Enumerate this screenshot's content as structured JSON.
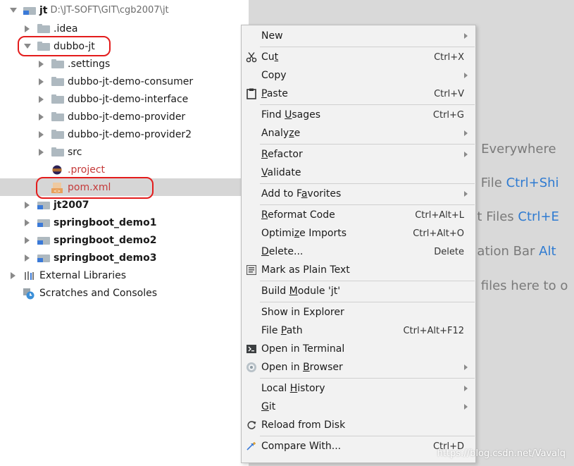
{
  "tree": {
    "root": {
      "label": "jt",
      "path": "D:\\JT-SOFT\\GIT\\cgb2007\\jt"
    },
    "items": [
      {
        "label": ".idea"
      },
      {
        "label": "dubbo-jt"
      },
      {
        "label": ".settings"
      },
      {
        "label": "dubbo-jt-demo-consumer"
      },
      {
        "label": "dubbo-jt-demo-interface"
      },
      {
        "label": "dubbo-jt-demo-provider"
      },
      {
        "label": "dubbo-jt-demo-provider2"
      },
      {
        "label": "src"
      },
      {
        "label": ".project"
      },
      {
        "label": "pom.xml"
      },
      {
        "label": "jt2007"
      },
      {
        "label": "springboot_demo1"
      },
      {
        "label": "springboot_demo2"
      },
      {
        "label": "springboot_demo3"
      },
      {
        "label": "External Libraries"
      },
      {
        "label": "Scratches and Consoles"
      }
    ]
  },
  "editor": {
    "hints": [
      {
        "text": "h Everywhere",
        "key": ""
      },
      {
        "text": "o File ",
        "key": "Ctrl+Shi"
      },
      {
        "text": "nt Files ",
        "key": "Ctrl+E"
      },
      {
        "text": "gation Bar ",
        "key": "Alt"
      },
      {
        "text": "o files here to o",
        "key": ""
      }
    ]
  },
  "menu": {
    "new": {
      "label": "New"
    },
    "cut": {
      "pre": "Cu",
      "u": "t",
      "post": "",
      "shortcut": "Ctrl+X"
    },
    "copy": {
      "label": "Copy"
    },
    "paste": {
      "pre": "",
      "u": "P",
      "post": "aste",
      "shortcut": "Ctrl+V"
    },
    "find_usages": {
      "pre": "Find ",
      "u": "U",
      "post": "sages",
      "shortcut": "Ctrl+G"
    },
    "analyze": {
      "pre": "Analy",
      "u": "z",
      "post": "e"
    },
    "refactor": {
      "pre": "",
      "u": "R",
      "post": "efactor"
    },
    "validate": {
      "pre": "",
      "u": "V",
      "post": "alidate"
    },
    "add_favorites": {
      "pre": "Add to F",
      "u": "a",
      "post": "vorites"
    },
    "reformat": {
      "pre": "",
      "u": "R",
      "post": "eformat Code",
      "shortcut": "Ctrl+Alt+L"
    },
    "optimize": {
      "pre": "Optimi",
      "u": "z",
      "post": "e Imports",
      "shortcut": "Ctrl+Alt+O"
    },
    "delete": {
      "pre": "",
      "u": "D",
      "post": "elete...",
      "shortcut": "Delete"
    },
    "mark_plain": {
      "label": "Mark as Plain Text"
    },
    "build_module": {
      "pre": "Build ",
      "u": "M",
      "post": "odule 'jt'"
    },
    "show_explorer": {
      "label": "Show in Explorer"
    },
    "file_path": {
      "pre": "File ",
      "u": "P",
      "post": "ath",
      "shortcut": "Ctrl+Alt+F12"
    },
    "open_terminal": {
      "label": "Open in Terminal"
    },
    "open_browser": {
      "pre": "Open in ",
      "u": "B",
      "post": "rowser"
    },
    "local_history": {
      "pre": "Local ",
      "u": "H",
      "post": "istory"
    },
    "git": {
      "pre": "",
      "u": "G",
      "post": "it"
    },
    "reload": {
      "label": "Reload from Disk"
    },
    "compare": {
      "label": "Compare With...",
      "shortcut": "Ctrl+D"
    }
  },
  "watermark": "https://blog.csdn.net/Vavalq",
  "colors": {
    "highlight": "#e31c1c",
    "module_blue": "#3b7ad8",
    "editor_bg": "#d9d9d9",
    "menu_bg": "#f2f2f2",
    "shortcut_key": "#2f7bd1"
  }
}
